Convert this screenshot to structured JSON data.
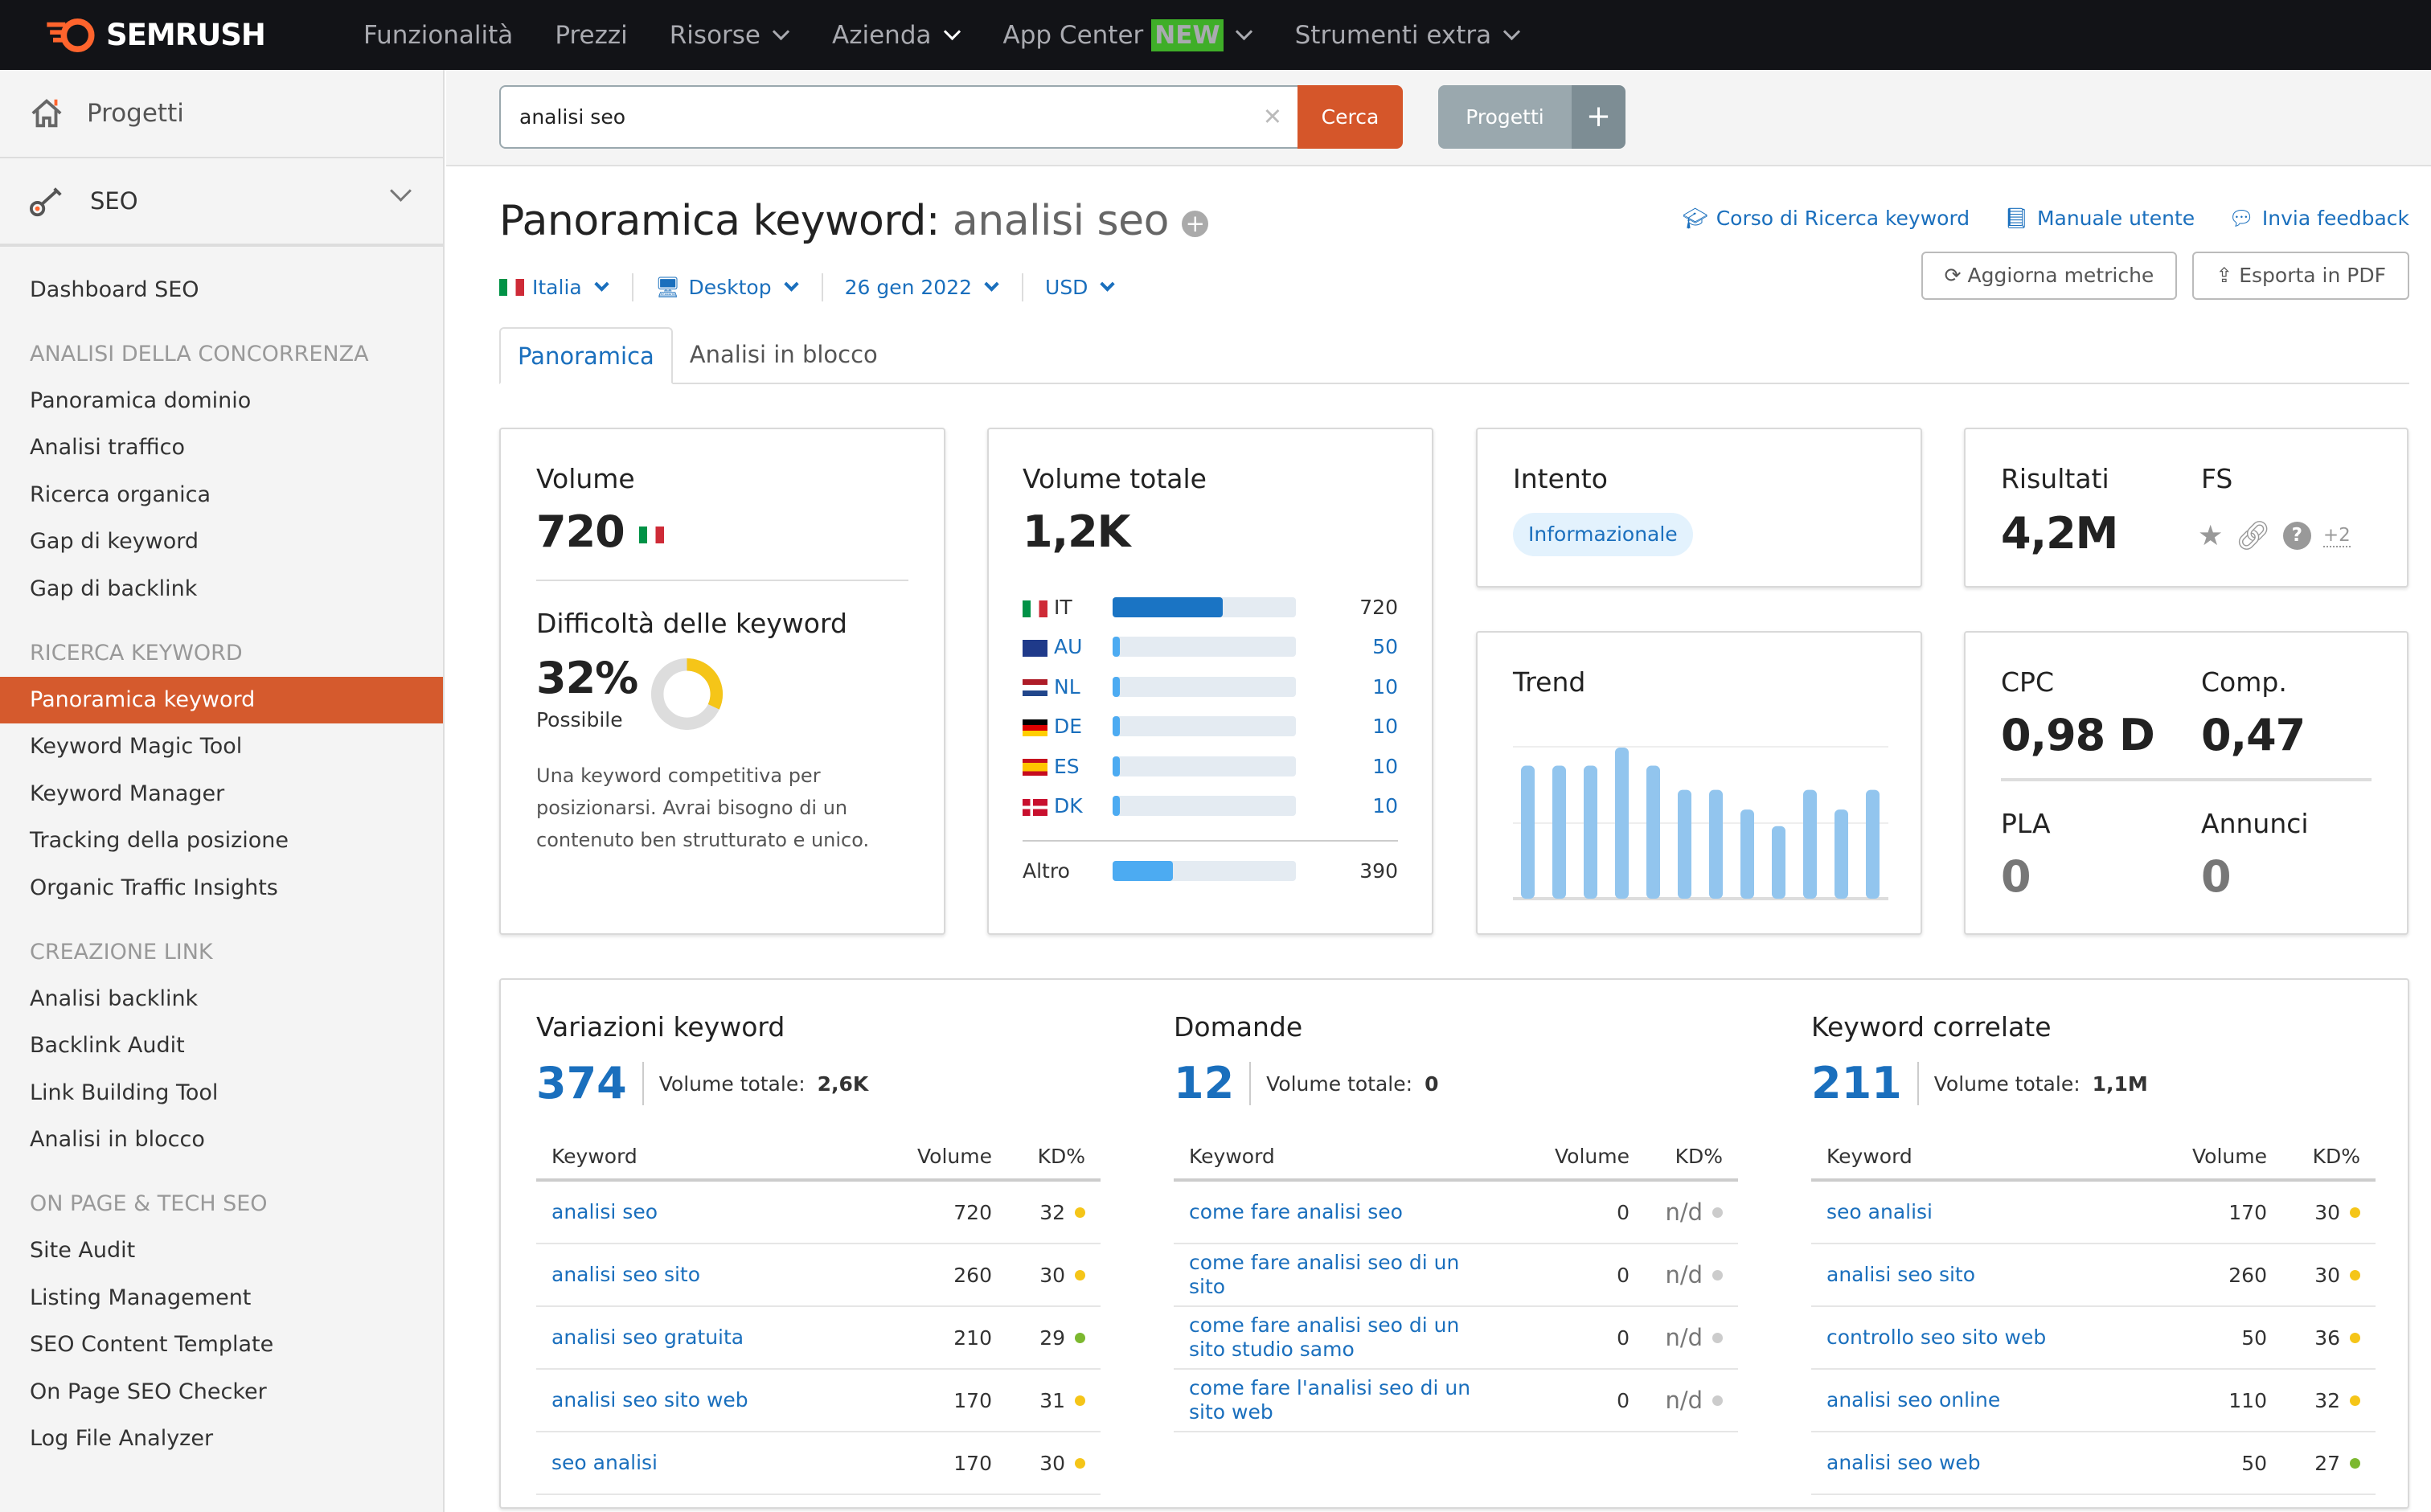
{
  "header": {
    "logo": "SEMRUSH",
    "nav": [
      {
        "label": "Funzionalità"
      },
      {
        "label": "Prezzi"
      },
      {
        "label": "Risorse",
        "dropdown": true
      },
      {
        "label": "Azienda",
        "dropdown": true,
        "active": true
      },
      {
        "label": "App Center",
        "badge": "NEW",
        "dropdown": true
      },
      {
        "label": "Strumenti extra",
        "dropdown": true
      }
    ]
  },
  "sidebar": {
    "projects": "Progetti",
    "section": "SEO",
    "items": [
      {
        "type": "item",
        "label": "Dashboard SEO"
      },
      {
        "type": "head",
        "label": "ANALISI DELLA CONCORRENZA"
      },
      {
        "type": "item",
        "label": "Panoramica dominio"
      },
      {
        "type": "item",
        "label": "Analisi traffico"
      },
      {
        "type": "item",
        "label": "Ricerca organica"
      },
      {
        "type": "item",
        "label": "Gap di keyword"
      },
      {
        "type": "item",
        "label": "Gap di backlink"
      },
      {
        "type": "head",
        "label": "RICERCA KEYWORD"
      },
      {
        "type": "item",
        "label": "Panoramica keyword",
        "active": true
      },
      {
        "type": "item",
        "label": "Keyword Magic Tool"
      },
      {
        "type": "item",
        "label": "Keyword Manager"
      },
      {
        "type": "item",
        "label": "Tracking della posizione"
      },
      {
        "type": "item",
        "label": "Organic Traffic Insights"
      },
      {
        "type": "head",
        "label": "CREAZIONE LINK"
      },
      {
        "type": "item",
        "label": "Analisi backlink"
      },
      {
        "type": "item",
        "label": "Backlink Audit"
      },
      {
        "type": "item",
        "label": "Link Building Tool"
      },
      {
        "type": "item",
        "label": "Analisi in blocco"
      },
      {
        "type": "head",
        "label": "ON PAGE & TECH SEO"
      },
      {
        "type": "item",
        "label": "Site Audit"
      },
      {
        "type": "item",
        "label": "Listing Management"
      },
      {
        "type": "item",
        "label": "SEO Content Template"
      },
      {
        "type": "item",
        "label": "On Page SEO Checker"
      },
      {
        "type": "item",
        "label": "Log File Analyzer"
      }
    ]
  },
  "search": {
    "value": "analisi seo",
    "button": "Cerca",
    "projects": "Progetti",
    "plus": "+"
  },
  "page": {
    "title": "Panoramica keyword:",
    "keyword": "analisi seo",
    "links": [
      "Corso di Ricerca keyword",
      "Manuale utente",
      "Invia feedback"
    ],
    "filters": [
      "Italia",
      "Desktop",
      "26 gen 2022",
      "USD"
    ],
    "buttons": [
      "Aggiorna metriche",
      "Esporta in PDF"
    ],
    "tabs": [
      "Panoramica",
      "Analisi in blocco"
    ]
  },
  "volume": {
    "title": "Volume",
    "value": "720",
    "kd_title": "Difficoltà delle keyword",
    "kd_value": "32%",
    "kd_percent": 32,
    "kd_label": "Possibile",
    "kd_desc": "Una keyword competitiva per posizionarsi. Avrai bisogno di un contenuto ben strutturato e unico."
  },
  "total_volume": {
    "title": "Volume totale",
    "value": "1,2K",
    "countries": [
      {
        "code": "IT",
        "value": "720",
        "fill": 0.6
      },
      {
        "code": "AU",
        "value": "50",
        "fill": 0.04
      },
      {
        "code": "NL",
        "value": "10",
        "fill": 0.02
      },
      {
        "code": "DE",
        "value": "10",
        "fill": 0.02
      },
      {
        "code": "ES",
        "value": "10",
        "fill": 0.02
      },
      {
        "code": "DK",
        "value": "10",
        "fill": 0.02
      }
    ],
    "other_label": "Altro",
    "other_value": "390",
    "other_fill": 0.33
  },
  "intent": {
    "title": "Intento",
    "value": "Informazionale"
  },
  "results": {
    "title": "Risultati",
    "value": "4,2M",
    "fs_title": "FS",
    "fs_more": "+2"
  },
  "trend": {
    "title": "Trend",
    "values": [
      0.88,
      0.88,
      0.88,
      1.0,
      0.88,
      0.72,
      0.72,
      0.59,
      0.48,
      0.72,
      0.59,
      0.72
    ]
  },
  "cpc": {
    "cpc_title": "CPC",
    "cpc": "0,98 D",
    "comp_title": "Comp.",
    "comp": "0,47",
    "pla_title": "PLA",
    "pla": "0",
    "ads_title": "Annunci",
    "ads": "0"
  },
  "colors": {
    "accent": "#d5562a",
    "link": "#1a6fbd",
    "kd_yellow": "#f5c518",
    "kd_green": "#7cb82f",
    "na_gray": "#cccccc"
  },
  "sections": [
    {
      "title": "Variazioni keyword",
      "count": "374",
      "vol_label": "Volume totale:",
      "vol": "2,6K",
      "cols": [
        "Keyword",
        "Volume",
        "KD%"
      ],
      "rows": [
        [
          "analisi seo",
          "720",
          "32",
          "y"
        ],
        [
          "analisi seo sito",
          "260",
          "30",
          "y"
        ],
        [
          "analisi seo gratuita",
          "210",
          "29",
          "g"
        ],
        [
          "analisi seo sito web",
          "170",
          "31",
          "y"
        ],
        [
          "seo analisi",
          "170",
          "30",
          "y"
        ]
      ]
    },
    {
      "title": "Domande",
      "count": "12",
      "vol_label": "Volume totale:",
      "vol": "0",
      "cols": [
        "Keyword",
        "Volume",
        "KD%"
      ],
      "rows": [
        [
          "come fare analisi seo",
          "0",
          "n/d",
          "n"
        ],
        [
          "come fare analisi seo di un sito",
          "0",
          "n/d",
          "n"
        ],
        [
          "come fare analisi seo di un sito studio samo",
          "0",
          "n/d",
          "n"
        ],
        [
          "come fare l'analisi seo di un sito web",
          "0",
          "n/d",
          "n"
        ]
      ]
    },
    {
      "title": "Keyword correlate",
      "count": "211",
      "vol_label": "Volume totale:",
      "vol": "1,1M",
      "cols": [
        "Keyword",
        "Volume",
        "KD%"
      ],
      "rows": [
        [
          "seo analisi",
          "170",
          "30",
          "y"
        ],
        [
          "analisi seo sito",
          "260",
          "30",
          "y"
        ],
        [
          "controllo seo sito web",
          "50",
          "36",
          "y"
        ],
        [
          "analisi seo online",
          "110",
          "32",
          "y"
        ],
        [
          "analisi seo web",
          "50",
          "27",
          "g"
        ]
      ]
    }
  ]
}
